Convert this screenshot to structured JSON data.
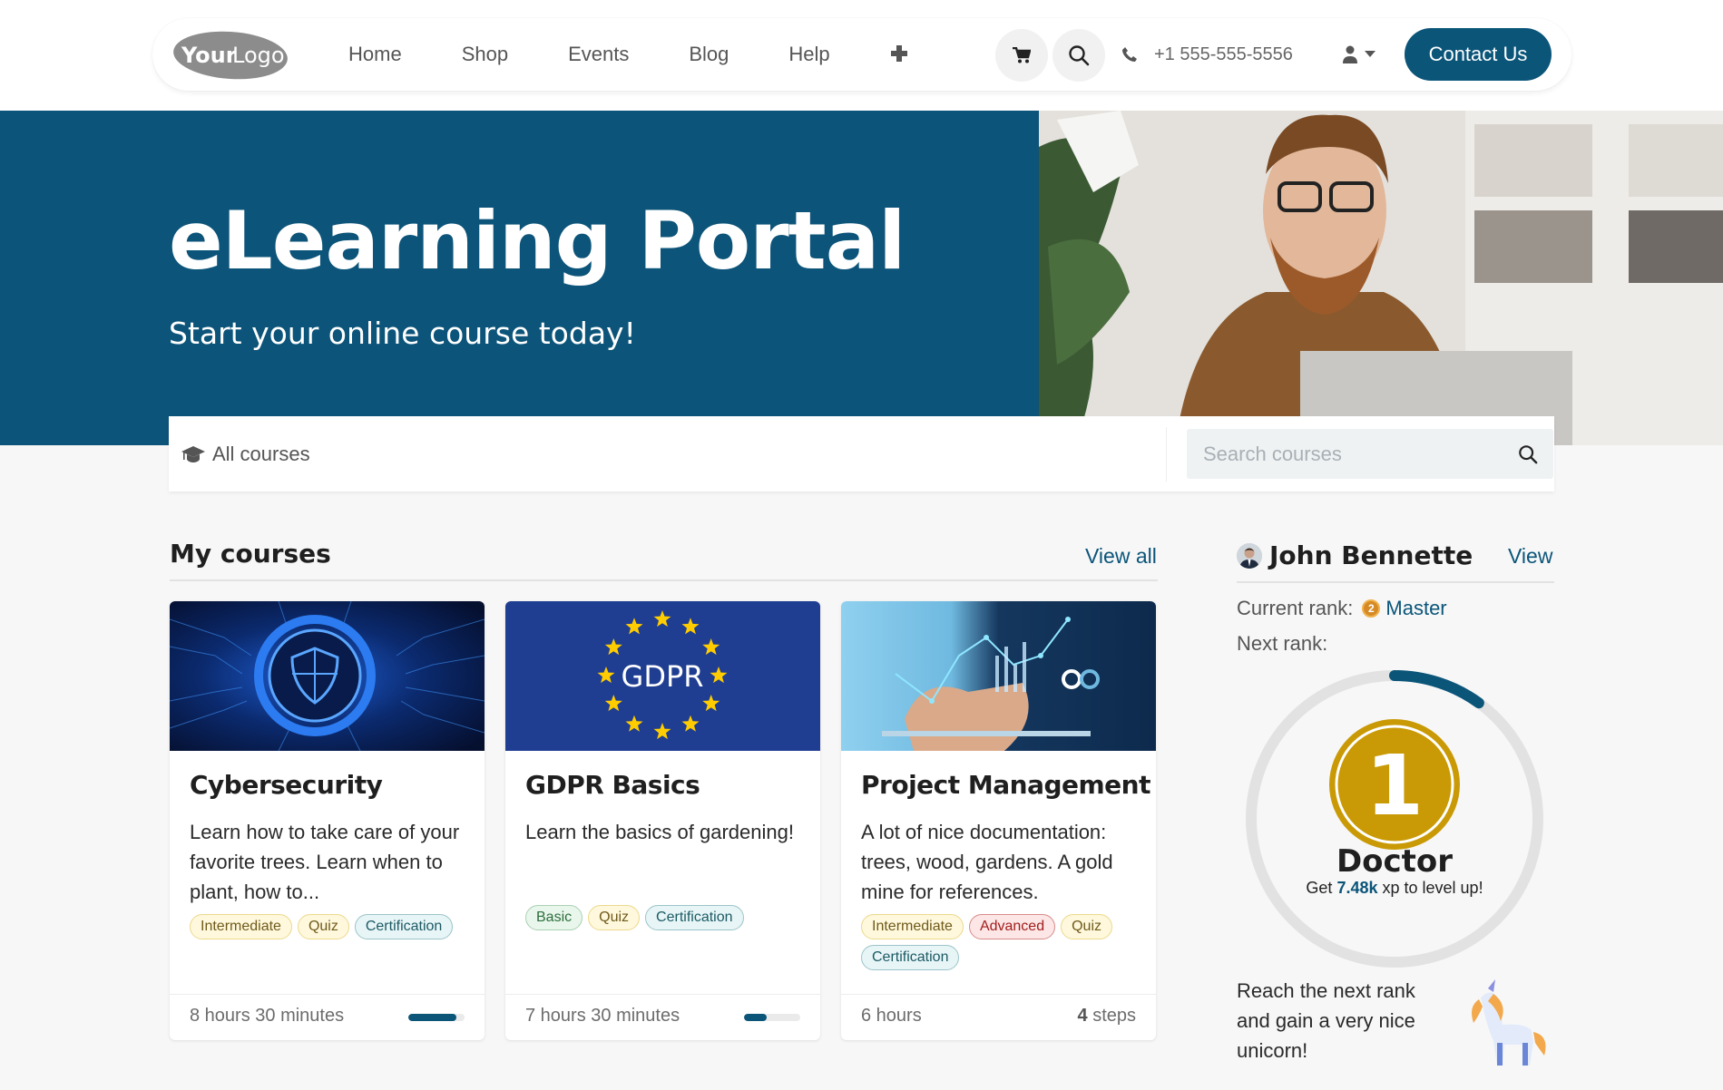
{
  "navbar": {
    "logo_text": "YourLogo",
    "links": [
      "Home",
      "Shop",
      "Events",
      "Blog",
      "Help"
    ],
    "phone": "+1 555-555-5556",
    "contact_label": "Contact Us",
    "icons": [
      "plus-icon",
      "cart-icon",
      "search-icon",
      "phone-icon",
      "user-icon",
      "caret-down-icon"
    ]
  },
  "hero": {
    "title": "eLearning Portal",
    "subtitle": "Start your online course today!"
  },
  "search": {
    "category_label": "All courses",
    "placeholder": "Search courses",
    "value": ""
  },
  "courses_section": {
    "title": "My courses",
    "view_all": "View all",
    "courses": [
      {
        "title": "Cybersecurity",
        "image": "cybersecurity-shield-circuit",
        "description": "Learn how to take care of your favorite trees. Learn when to plant, how to...",
        "tags": [
          {
            "label": "Intermediate",
            "color": "yellow"
          },
          {
            "label": "Quiz",
            "color": "yellow"
          },
          {
            "label": "Certification",
            "color": "teal"
          }
        ],
        "duration": "8 hours 30 minutes",
        "progress_percent": 86
      },
      {
        "title": "GDPR Basics",
        "image": "gdpr-eu-stars",
        "image_text": "GDPR",
        "description": "Learn the basics of gardening!",
        "tags": [
          {
            "label": "Basic",
            "color": "green"
          },
          {
            "label": "Quiz",
            "color": "yellow"
          },
          {
            "label": "Certification",
            "color": "teal"
          }
        ],
        "duration": "7 hours 30 minutes",
        "progress_percent": 40
      },
      {
        "title": "Project Management",
        "image": "analytics-charts-tablet",
        "description": "A lot of nice documentation: trees, wood, gardens. A gold mine for references.",
        "tags": [
          {
            "label": "Intermediate",
            "color": "yellow"
          },
          {
            "label": "Advanced",
            "color": "red"
          },
          {
            "label": "Quiz",
            "color": "yellow"
          },
          {
            "label": "Certification",
            "color": "teal"
          }
        ],
        "duration": "6 hours",
        "steps_count": "4",
        "steps_label": "steps"
      }
    ]
  },
  "profile": {
    "name": "John Bennette",
    "view_label": "View",
    "current_rank_label": "Current rank:",
    "current_rank_number": "2",
    "current_rank": "Master",
    "next_rank_label": "Next rank:",
    "next_rank_number": "1",
    "next_rank": "Doctor",
    "xp_prefix": "Get",
    "xp_value": "7.48k",
    "xp_suffix": "xp to level up!",
    "rank_progress_percent": 10,
    "reward_text": "Reach the next rank and gain a very nice unicorn!"
  },
  "colors": {
    "primary": "#0b5579",
    "medal_gold": "#c99a06",
    "page_bg": "#f7f7f7"
  }
}
